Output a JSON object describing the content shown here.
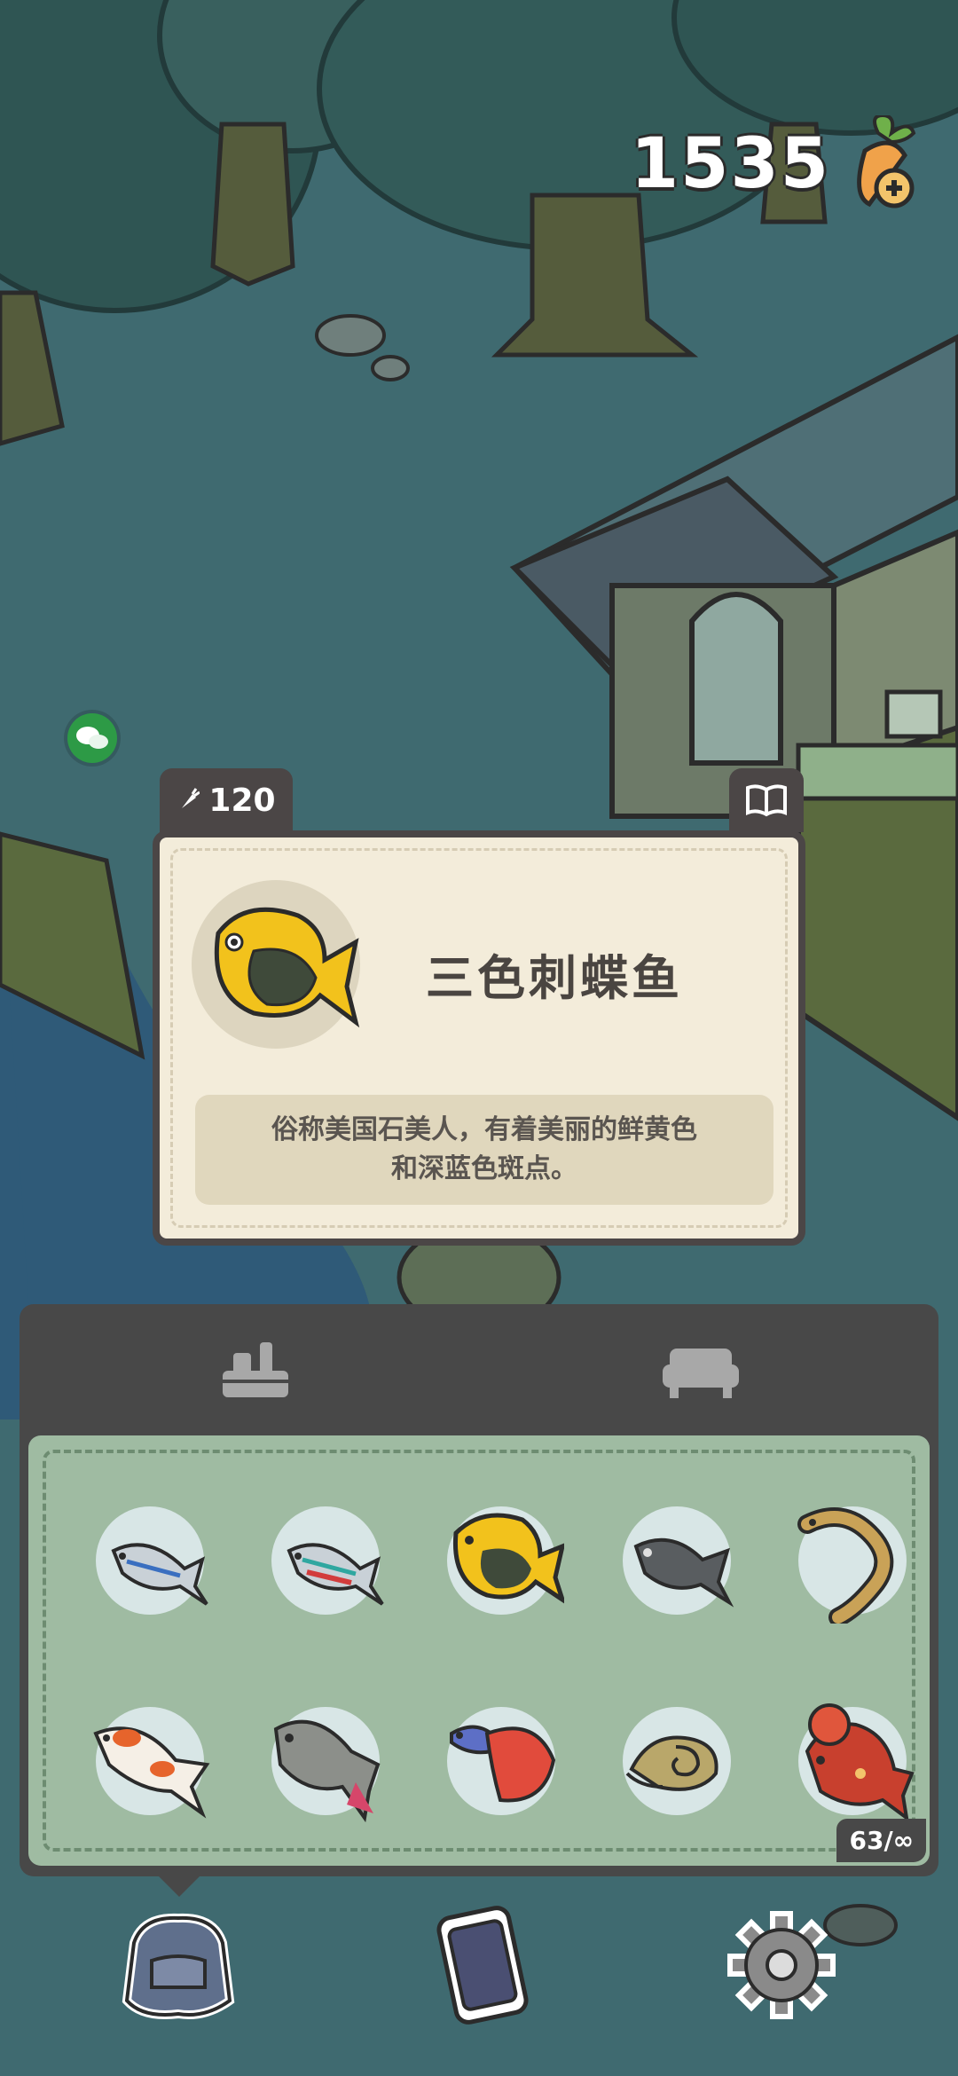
{
  "hud": {
    "carrots": "1535",
    "carrot_icon": "carrot-plus-icon"
  },
  "fish_card": {
    "price": "120",
    "name": "三色刺蝶鱼",
    "description_line1": "俗称美国石美人，有着美丽的鲜黄色",
    "description_line2": "和深蓝色斑点。"
  },
  "inventory": {
    "tabs": [
      {
        "icon": "fishing-gear-icon"
      },
      {
        "icon": "sofa-icon"
      }
    ],
    "items": [
      {
        "icon": "neon-tetra-fish-icon"
      },
      {
        "icon": "cardinal-tetra-fish-icon"
      },
      {
        "icon": "rock-beauty-fish-icon"
      },
      {
        "icon": "black-molly-fish-icon"
      },
      {
        "icon": "eel-icon"
      },
      {
        "icon": "koi-fish-icon"
      },
      {
        "icon": "crucian-carp-icon"
      },
      {
        "icon": "betta-fish-icon"
      },
      {
        "icon": "snail-icon"
      },
      {
        "icon": "flowerhorn-fish-icon"
      }
    ],
    "counter": "63/∞"
  },
  "bottom_bar": [
    {
      "icon": "backpack-icon"
    },
    {
      "icon": "phone-icon"
    },
    {
      "icon": "settings-gear-icon"
    }
  ],
  "colors": {
    "panel": "#484848",
    "card_bg": "#f3ecda",
    "grid_bg": "#9fbba2",
    "accent_yellow": "#f2c21c"
  }
}
